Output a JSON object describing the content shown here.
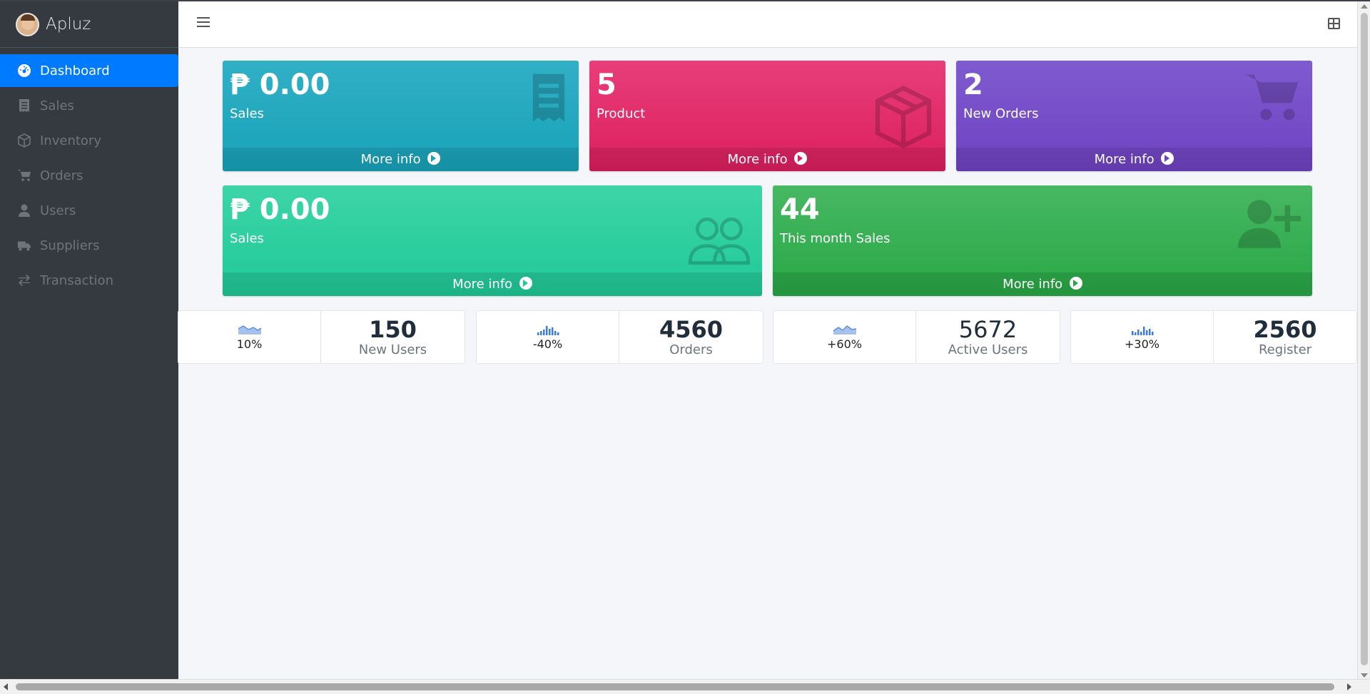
{
  "brand": {
    "name": "Apluz"
  },
  "sidebar": {
    "items": [
      {
        "label": "Dashboard",
        "icon": "dashboard-icon",
        "active": true
      },
      {
        "label": "Sales",
        "icon": "receipt-icon"
      },
      {
        "label": "Inventory",
        "icon": "box-icon"
      },
      {
        "label": "Orders",
        "icon": "cart-icon"
      },
      {
        "label": "Users",
        "icon": "user-icon"
      },
      {
        "label": "Suppliers",
        "icon": "truck-icon"
      },
      {
        "label": "Transaction",
        "icon": "exchange-icon"
      }
    ]
  },
  "boxes": [
    {
      "value": "₱ 0.00",
      "label": "Sales",
      "footer": "More info",
      "icon": "receipt-icon",
      "color": "#17a2b8"
    },
    {
      "value": "5",
      "label": "Product",
      "footer": "More info",
      "icon": "box-icon",
      "color": "#dc1f5f"
    },
    {
      "value": "2",
      "label": "New Orders",
      "footer": "More info",
      "icon": "cart-icon",
      "color": "#6f42c1"
    },
    {
      "value": "₱ 0.00",
      "label": "Sales",
      "footer": "More info",
      "icon": "users-icon",
      "color": "#20c997"
    },
    {
      "value": "44",
      "label": "This month Sales",
      "footer": "More info",
      "icon": "user-plus-icon",
      "color": "#28a745"
    }
  ],
  "stats": [
    {
      "percent": "10%",
      "value": "150",
      "caption": "New Users",
      "spark": "area"
    },
    {
      "percent": "-40%",
      "value": "4560",
      "caption": "Orders",
      "spark": "bar"
    },
    {
      "percent": "+60%",
      "value": "5672",
      "caption": "Active Users",
      "spark": "area"
    },
    {
      "percent": "+30%",
      "value": "2560",
      "caption": "Register",
      "spark": "bar"
    }
  ]
}
